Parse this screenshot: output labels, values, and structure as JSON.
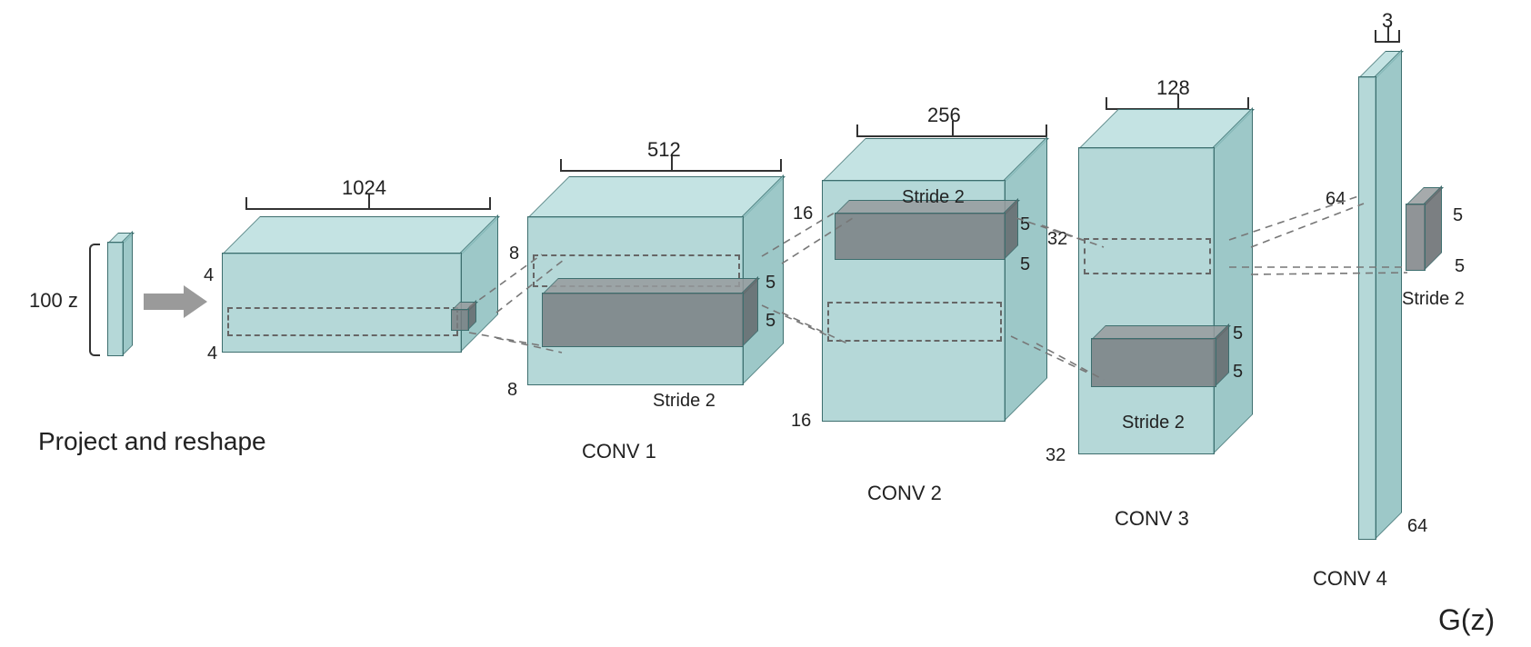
{
  "input": {
    "label": "100 z",
    "caption": "Project and reshape"
  },
  "layers": [
    {
      "name": "reshape",
      "channels": "1024",
      "h": "4",
      "w": "4",
      "stride": "",
      "label": ""
    },
    {
      "name": "conv1",
      "channels": "512",
      "h": "8",
      "w": "8",
      "stride": "Stride 2",
      "label": "CONV 1",
      "kh": "5",
      "kw": "5"
    },
    {
      "name": "conv2",
      "channels": "256",
      "h": "16",
      "w": "16",
      "stride": "Stride 2",
      "label": "CONV 2",
      "kh": "5",
      "kw": "5"
    },
    {
      "name": "conv3",
      "channels": "128",
      "h": "32",
      "w": "32",
      "stride": "Stride 2",
      "label": "CONV 3",
      "kh": "5",
      "kw": "5"
    },
    {
      "name": "conv4",
      "channels": "3",
      "h": "64",
      "w": "64",
      "stride": "Stride 2",
      "label": "CONV 4",
      "kh": "5",
      "kw": "5"
    }
  ],
  "output_label": "G(z)",
  "chart_data": {
    "type": "diagram",
    "title": "DCGAN generator architecture",
    "input": {
      "z_dim": 100
    },
    "stages": [
      {
        "op": "project-and-reshape",
        "out_shape": [
          4,
          4,
          1024
        ]
      },
      {
        "op": "transposed-conv",
        "name": "CONV 1",
        "kernel": [
          5,
          5
        ],
        "stride": 2,
        "out_shape": [
          8,
          8,
          512
        ]
      },
      {
        "op": "transposed-conv",
        "name": "CONV 2",
        "kernel": [
          5,
          5
        ],
        "stride": 2,
        "out_shape": [
          16,
          16,
          256
        ]
      },
      {
        "op": "transposed-conv",
        "name": "CONV 3",
        "kernel": [
          5,
          5
        ],
        "stride": 2,
        "out_shape": [
          32,
          32,
          128
        ]
      },
      {
        "op": "transposed-conv",
        "name": "CONV 4",
        "kernel": [
          5,
          5
        ],
        "stride": 2,
        "out_shape": [
          64,
          64,
          3
        ]
      }
    ],
    "output": "G(z)"
  }
}
